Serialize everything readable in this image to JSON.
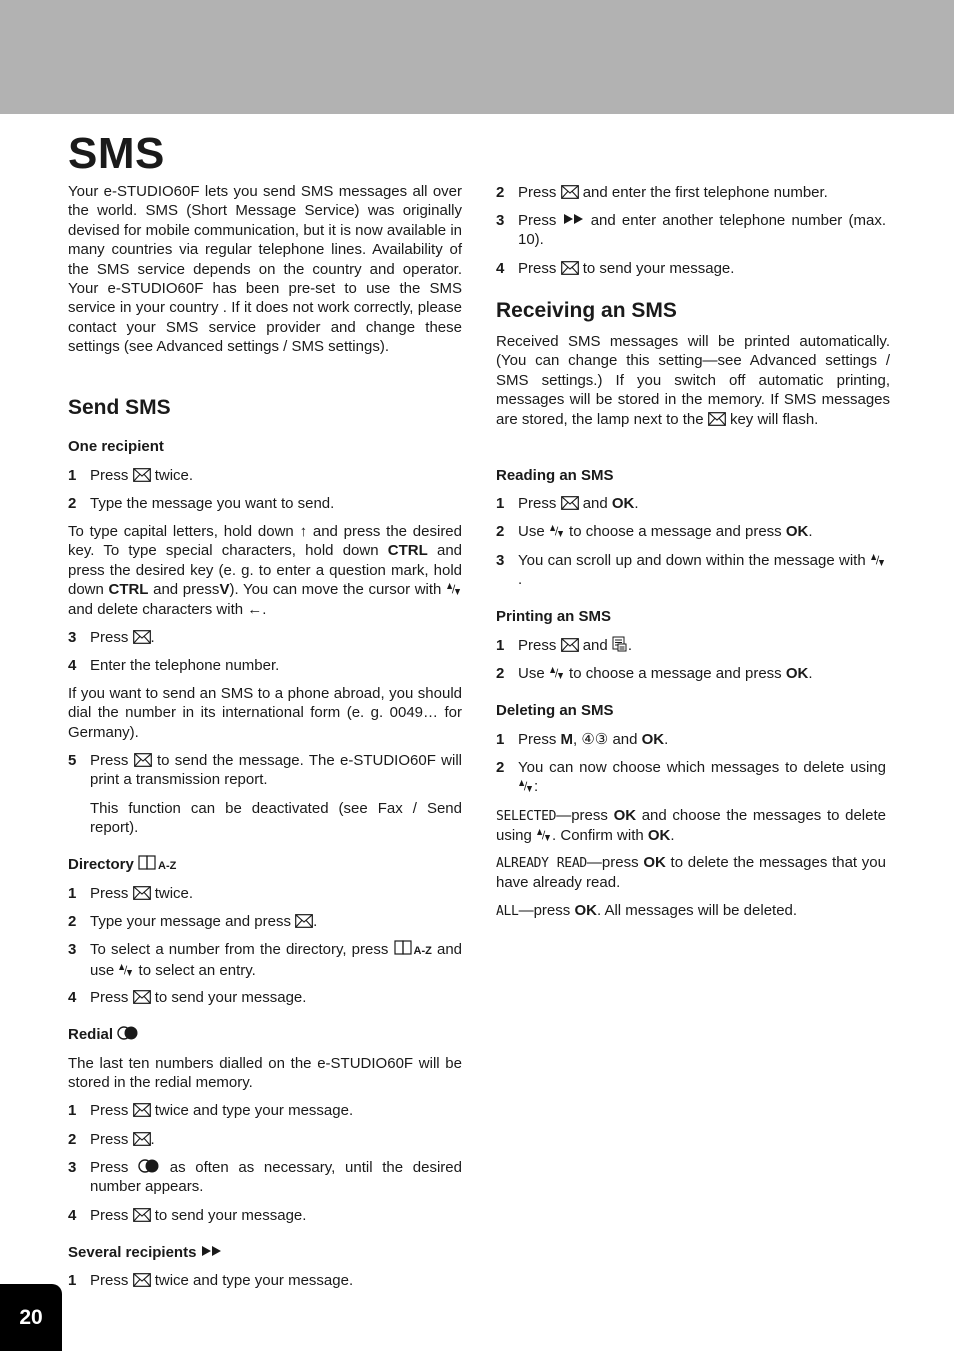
{
  "page": {
    "title": "SMS",
    "page_number": "20",
    "band_color": "#b2b2b2"
  },
  "intro": "Your e-STUDIO60F lets you send SMS messages all over the world. SMS (Short Message Service) was originally devised for mobile communication, but it is now available in many countries via regular telephone lines. Availability of the SMS service depends on the country and operator. Your e-STUDIO60F has been pre-set to use the SMS service in your country . If it does not work correctly, please contact your SMS service provider and change these settings (see Advanced settings / SMS settings).",
  "send": {
    "heading": "Send SMS",
    "one_recipient": {
      "heading": "One recipient",
      "s1": {
        "n": "1",
        "a": "Press",
        "b": "twice."
      },
      "s2": {
        "n": "2",
        "a": "Type the message you want to send."
      },
      "note": {
        "a": "To type capital letters, hold down",
        "b": "and press the desired key. To type special characters, hold down",
        "ctrl": "CTRL",
        "c": "and press the desired key (e. g. to enter a question mark, hold down",
        "d": "and press",
        "v": "V",
        "e": "). You can move the cursor with",
        "f": "and delete characters with",
        "g": "."
      },
      "s3": {
        "n": "3",
        "a": "Press",
        "b": "."
      },
      "s4": {
        "n": "4",
        "a": "Enter the telephone number."
      },
      "abroad": "If you want to send an SMS to a phone abroad, you should dial the number in its international form (e. g. 0049… for Germany).",
      "s5": {
        "n": "5",
        "a": "Press",
        "b": "to send the message. The e-STUDIO60F will print a transmission report."
      },
      "s5_note": "This function can be deactivated (see Fax / Send report)."
    },
    "directory": {
      "heading": "Directory",
      "az": "A-Z",
      "s1": {
        "n": "1",
        "a": "Press",
        "b": "twice."
      },
      "s2": {
        "n": "2",
        "a": "Type your message and press",
        "b": "."
      },
      "s3": {
        "n": "3",
        "a": "To select a number from the directory, press",
        "b": "and use",
        "c": "to select an entry."
      },
      "s4": {
        "n": "4",
        "a": "Press",
        "b": "to send your message."
      }
    },
    "redial": {
      "heading": "Redial",
      "intro": "The last ten numbers dialled on the e-STUDIO60F will be stored in the redial memory.",
      "s1": {
        "n": "1",
        "a": "Press",
        "b": "twice and type your message."
      },
      "s2": {
        "n": "2",
        "a": "Press",
        "b": "."
      },
      "s3": {
        "n": "3",
        "a": "Press",
        "b": "as often as necessary, until the desired number appears."
      },
      "s4": {
        "n": "4",
        "a": "Press",
        "b": "to send your message."
      }
    },
    "several": {
      "heading": "Several recipients",
      "s1": {
        "n": "1",
        "a": "Press",
        "b": "twice and type your message."
      },
      "s2": {
        "n": "2",
        "a": "Press",
        "b": "and enter the first telephone number."
      },
      "s3": {
        "n": "3",
        "a": "Press",
        "b": "and enter another telephone number (max. 10)."
      },
      "s4": {
        "n": "4",
        "a": "Press",
        "b": "to send your message."
      }
    }
  },
  "receive": {
    "heading": "Receiving an SMS",
    "intro_a": "Received SMS messages will be printed automatically. (You can change this setting—see Advanced settings / SMS settings.) If you switch off automatic printing, messages will be stored in the memory. If SMS messages are stored, the lamp next to the",
    "intro_b": "key will flash.",
    "reading": {
      "heading": "Reading an SMS",
      "s1": {
        "n": "1",
        "a": "Press",
        "b": "and",
        "ok": "OK",
        "c": "."
      },
      "s2": {
        "n": "2",
        "a": "Use",
        "b": "to choose a message and press",
        "ok": "OK",
        "c": "."
      },
      "s3": {
        "n": "3",
        "a": "You can scroll up and down within the message with",
        "b": "."
      }
    },
    "printing": {
      "heading": "Printing an SMS",
      "s1": {
        "n": "1",
        "a": "Press",
        "b": "and",
        "c": "."
      },
      "s2": {
        "n": "2",
        "a": "Use",
        "b": "to choose a message and press",
        "ok": "OK",
        "c": "."
      }
    },
    "deleting": {
      "heading": "Deleting an SMS",
      "s1": {
        "n": "1",
        "a": "Press",
        "m": "M",
        "comma": ",",
        "keys": "④③",
        "b": "and",
        "ok": "OK",
        "c": "."
      },
      "s2": {
        "n": "2",
        "a": "You can now choose which messages to delete using",
        "b": ":"
      },
      "opt_selected": {
        "lcd": "SELECTED",
        "a": "—press",
        "ok": "OK",
        "b": "and choose the messages to delete using",
        "c": ". Confirm with",
        "ok2": "OK",
        "d": "."
      },
      "opt_read": {
        "lcd": "ALREADY READ",
        "a": "—press",
        "ok": "OK",
        "b": "to delete the messages that you have already read."
      },
      "opt_all": {
        "lcd": "ALL",
        "a": "—press",
        "ok": "OK",
        "b": ". All messages will be deleted."
      }
    }
  },
  "icons": {
    "envelope": "envelope-key",
    "arrows": "up-down-arrow-keys",
    "shift": "shift-arrow-key",
    "backspace": "backspace-arrow-key",
    "book": "directory-book-key",
    "redial": "redial-key",
    "ff": "several-recipients-key",
    "print": "print-key"
  }
}
